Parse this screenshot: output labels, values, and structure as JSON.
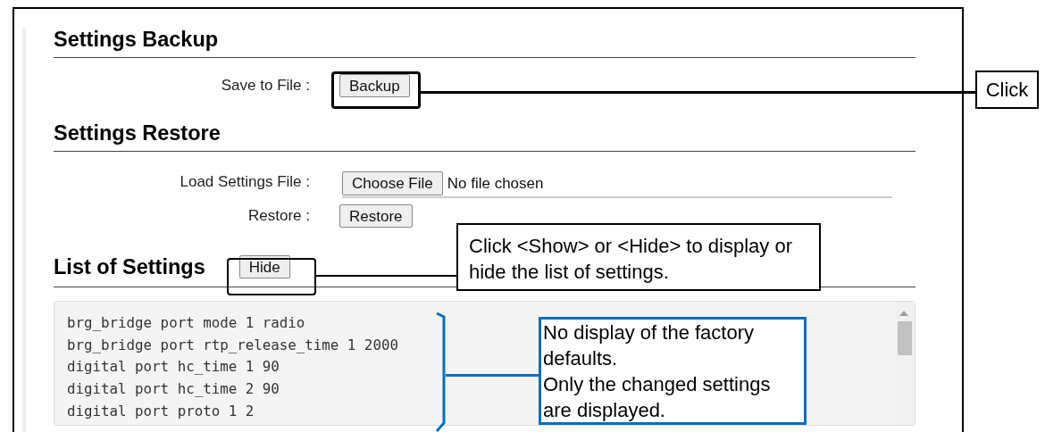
{
  "sections": [
    {
      "title": "Settings Backup",
      "rows": [
        {
          "kind": "button",
          "label": "Save to File :",
          "button": "Backup"
        }
      ]
    },
    {
      "title": "Settings Restore",
      "rows": [
        {
          "kind": "file",
          "label": "Load Settings File :",
          "button": "Choose File",
          "file_status": "No file chosen"
        },
        {
          "kind": "button",
          "label": "Restore :",
          "button": "Restore"
        }
      ]
    }
  ],
  "list": {
    "title": "List of Settings",
    "toggle": "Hide",
    "lines": [
      "brg_bridge port mode 1 radio",
      "brg_bridge port rtp_release_time 1 2000",
      "digital port hc_time 1 90",
      "digital port hc_time 2 90",
      "digital port proto 1 2"
    ]
  },
  "annotations": {
    "backup_callout": "Click",
    "toggle_callout": "Click <Show> or <Hide> to display or hide the list of settings.",
    "list_callout": "No display of the factory defaults.\nOnly the changed settings are displayed."
  }
}
